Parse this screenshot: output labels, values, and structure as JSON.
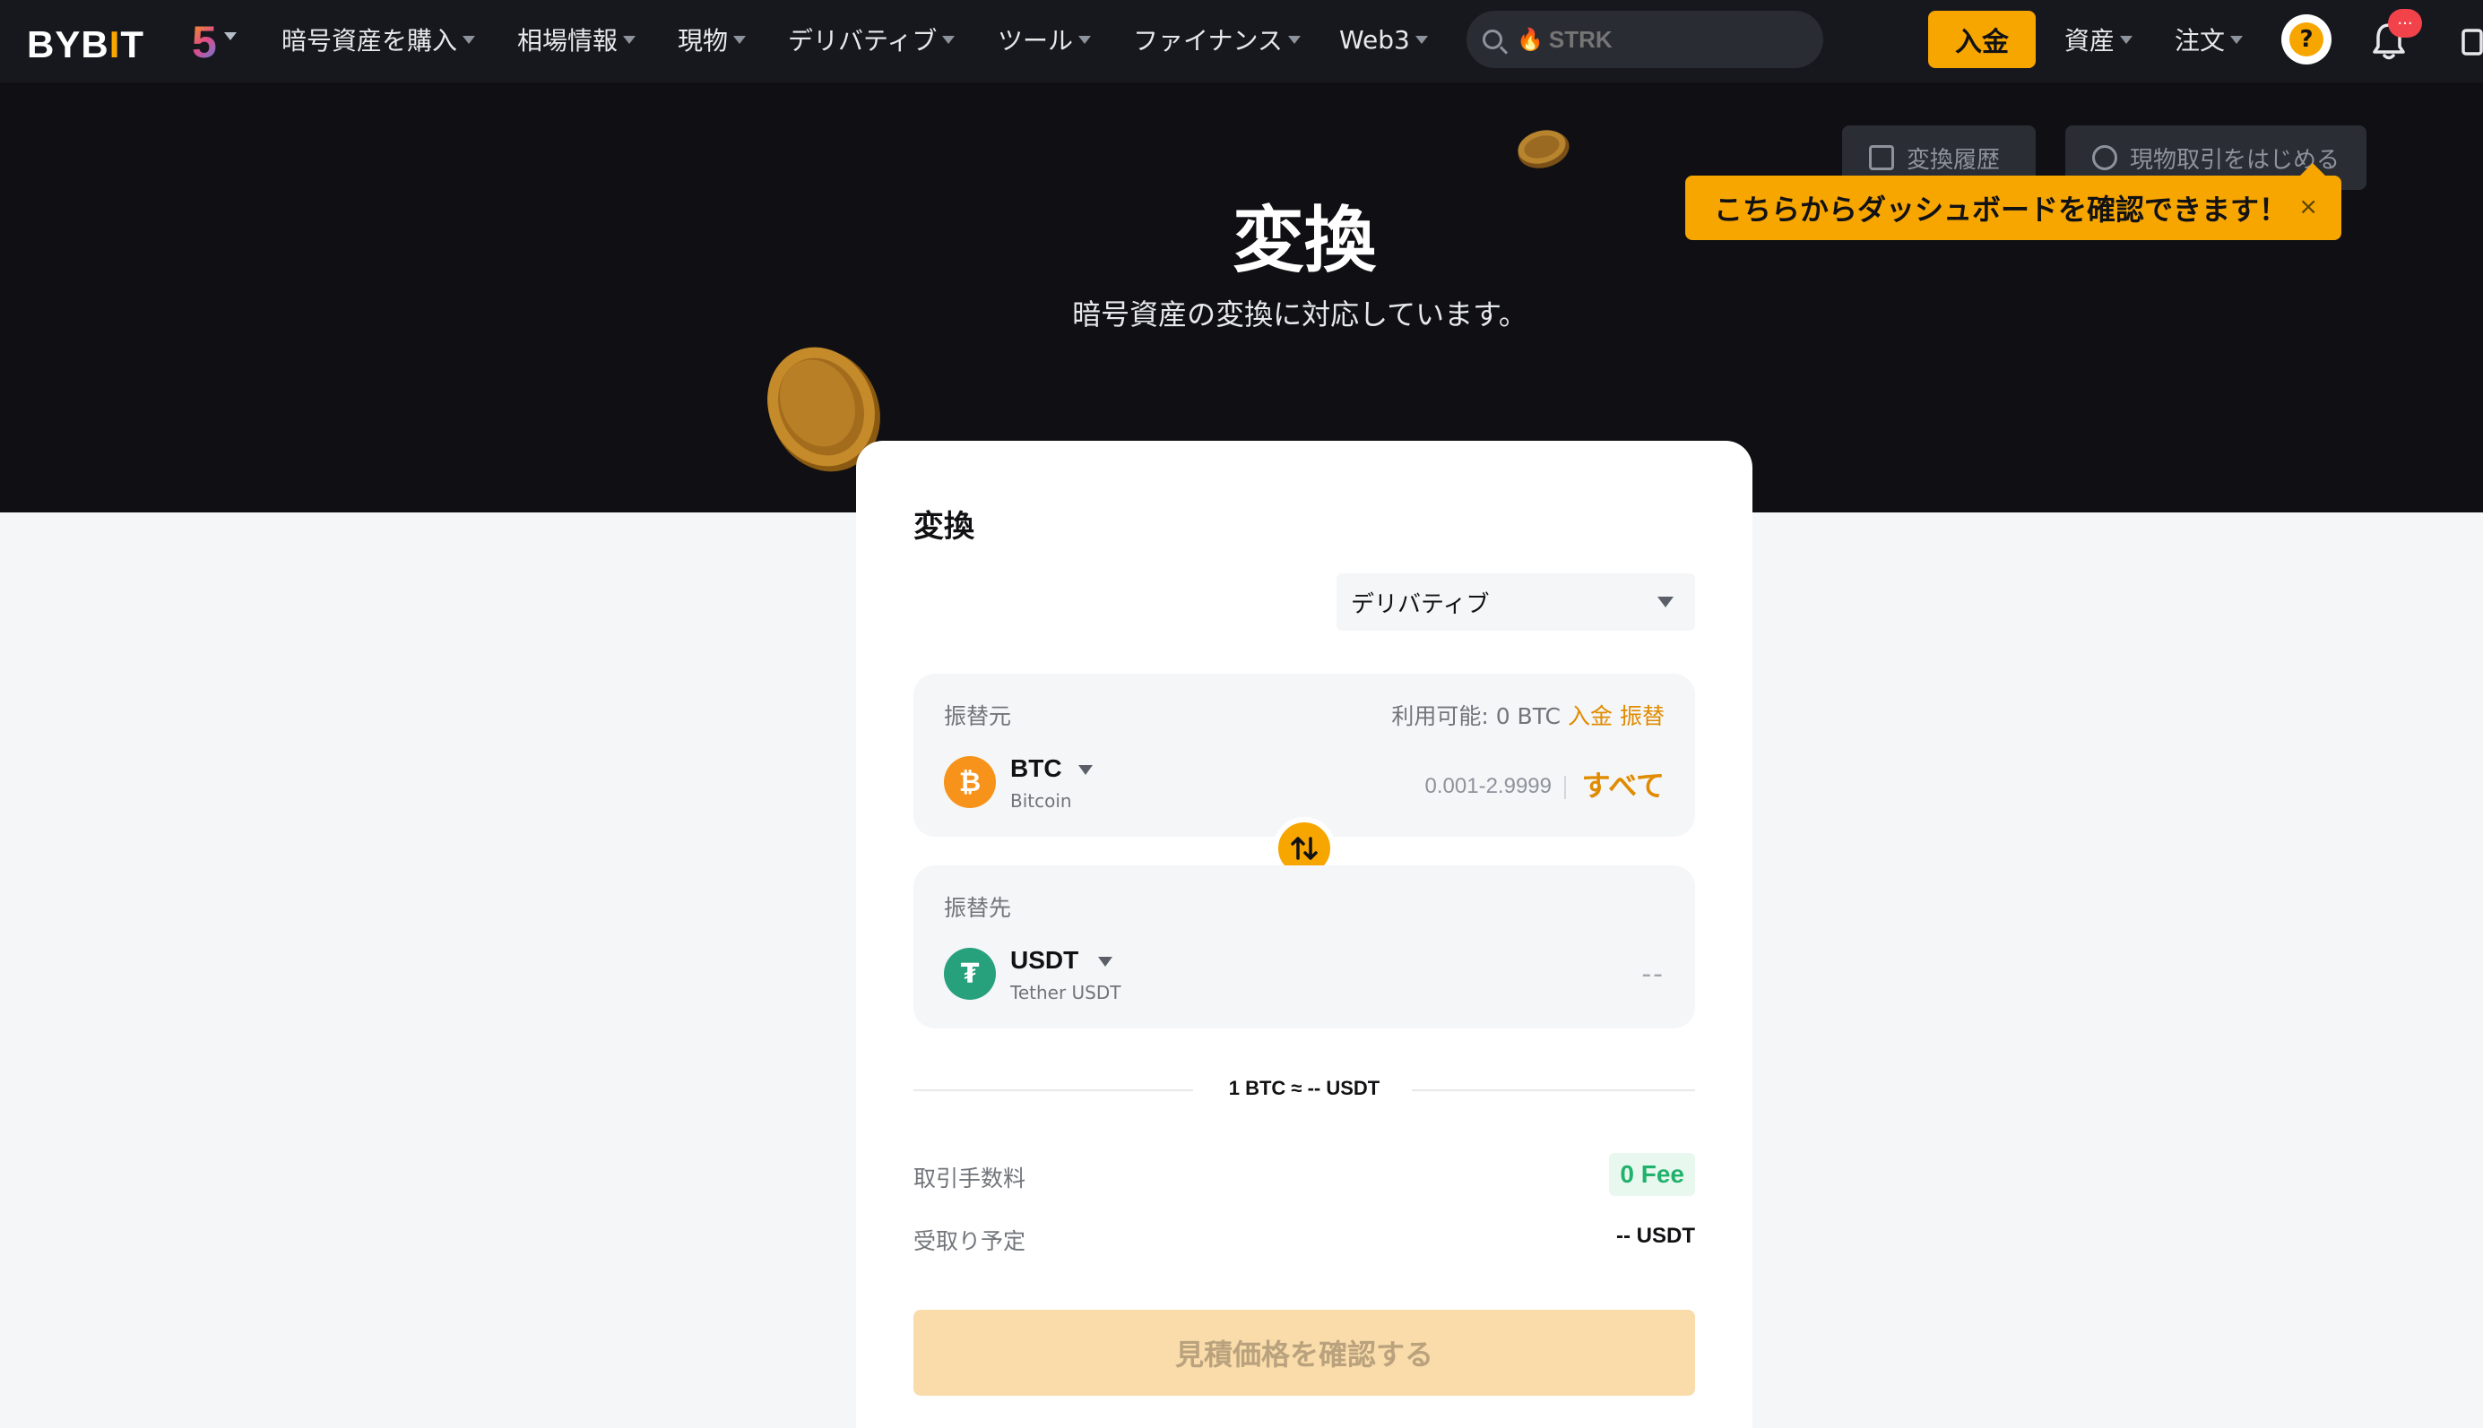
{
  "nav": {
    "logo": "BYB",
    "logo_bang": "I",
    "logo_end": "T",
    "anniversary": "5",
    "items": [
      {
        "label": "暗号資産を購入"
      },
      {
        "label": "相場情報"
      },
      {
        "label": "現物"
      },
      {
        "label": "デリバティブ"
      },
      {
        "label": "ツール"
      },
      {
        "label": "ファイナンス"
      },
      {
        "label": "Web3"
      }
    ],
    "search_placeholder": "STRK",
    "deposit_label": "入金",
    "assets_label": "資産",
    "orders_label": "注文",
    "notification_badge": "···",
    "accent_color": "#f7a600"
  },
  "hero": {
    "title": "変換",
    "subtitle": "暗号資産の変換に対応しています。",
    "history_button": "変換履歴",
    "spot_button": "現物取引をはじめる",
    "tooltip_text": "こちらからダッシュボードを確認できます！",
    "tooltip_close": "×"
  },
  "converter": {
    "title": "変換",
    "account_type": "デリバティブ",
    "from": {
      "label": "振替元",
      "available_prefix": "利用可能: 0 BTC",
      "deposit_link": "入金",
      "transfer_link": "振替",
      "symbol": "BTC",
      "name": "Bitcoin",
      "range": "0.001-2.9999",
      "all_label": "すべて",
      "icon_color": "#f7931a"
    },
    "to": {
      "label": "振替先",
      "symbol": "USDT",
      "name": "Tether USDT",
      "value": "--",
      "icon_color": "#26a17b"
    },
    "rate": "1 BTC ≈ -- USDT",
    "fee_label": "取引手数料",
    "fee_value": "0 Fee",
    "receive_label": "受取り予定",
    "receive_value": "-- USDT",
    "quote_button": "見積価格を確認する"
  }
}
